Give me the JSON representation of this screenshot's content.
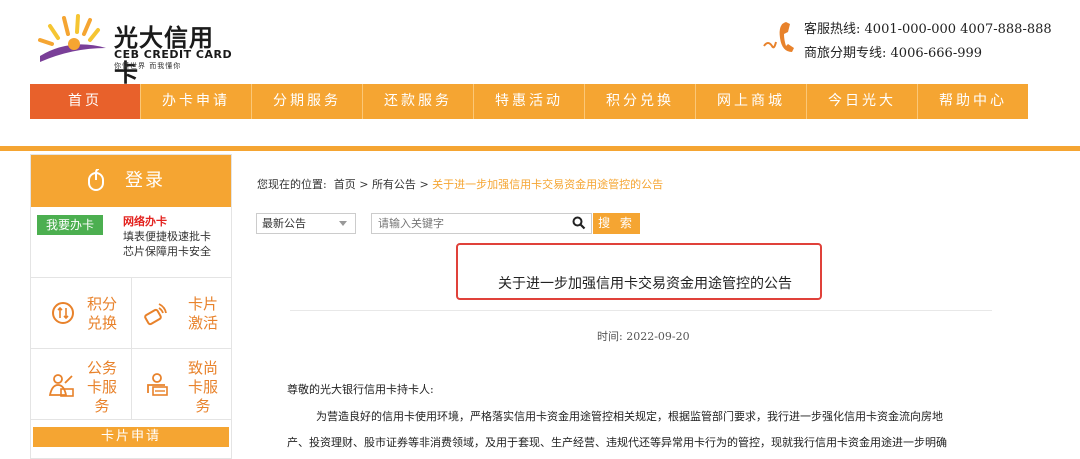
{
  "header": {
    "logo_cn": "光大信用卡",
    "logo_en": "CEB CREDIT CARD",
    "logo_sub": "你懂世界  而我懂你",
    "hotline_label_1": "客服热线:",
    "hotline_value_1": "4001-000-000  4007-888-888",
    "hotline_label_2": "商旅分期专线:",
    "hotline_value_2": "4006-666-999"
  },
  "nav": {
    "items": [
      "首页",
      "办卡申请",
      "分期服务",
      "还款服务",
      "特惠活动",
      "积分兑换",
      "网上商城",
      "今日光大",
      "帮助中心"
    ],
    "active_index": 0
  },
  "sidebar": {
    "login_label": "登录",
    "apply_button": "我要办卡",
    "apply_title": "网络办卡",
    "apply_desc_1": "填表便捷极速批卡",
    "apply_desc_2": "芯片保障用卡安全",
    "tiles": [
      {
        "label_1": "积分",
        "label_2": "兑换",
        "label_3": "",
        "icon": "points-exchange-icon"
      },
      {
        "label_1": "卡片",
        "label_2": "激活",
        "label_3": "",
        "icon": "card-activate-icon"
      },
      {
        "label_1": "公务",
        "label_2": "卡服",
        "label_3": "务",
        "icon": "official-card-icon"
      },
      {
        "label_1": "致尚",
        "label_2": "卡服",
        "label_3": "务",
        "icon": "premium-card-icon"
      }
    ],
    "card_apply_label": "卡片申请"
  },
  "breadcrumb": {
    "prefix": "您现在的位置:",
    "home": "首页",
    "sep": ">",
    "section": "所有公告",
    "current": "关于进一步加强信用卡交易资金用途管控的公告"
  },
  "filter": {
    "select_value": "最新公告",
    "search_placeholder": "请输入关键字",
    "search_button": "搜 索"
  },
  "article": {
    "title": "关于进一步加强信用卡交易资金用途管控的公告",
    "time_label": "时间:",
    "time_value": "2022-09-20",
    "greeting": "尊敬的光大银行信用卡持卡人:",
    "para_line_1": "为营造良好的信用卡使用环境，严格落实信用卡资金用途管控相关规定，根据监管部门要求，我行进一步强化信用卡资金流向房地",
    "para_line_2": "产、投资理财、股市证券等非消费领域，及用于套现、生产经营、违规代还等异常用卡行为的管控，现就我行信用卡资金用途进一步明确"
  },
  "colors": {
    "brand_orange": "#f5a532",
    "nav_active": "#e8612b",
    "highlight_red": "#e0413a",
    "apply_green": "#4caf50"
  }
}
